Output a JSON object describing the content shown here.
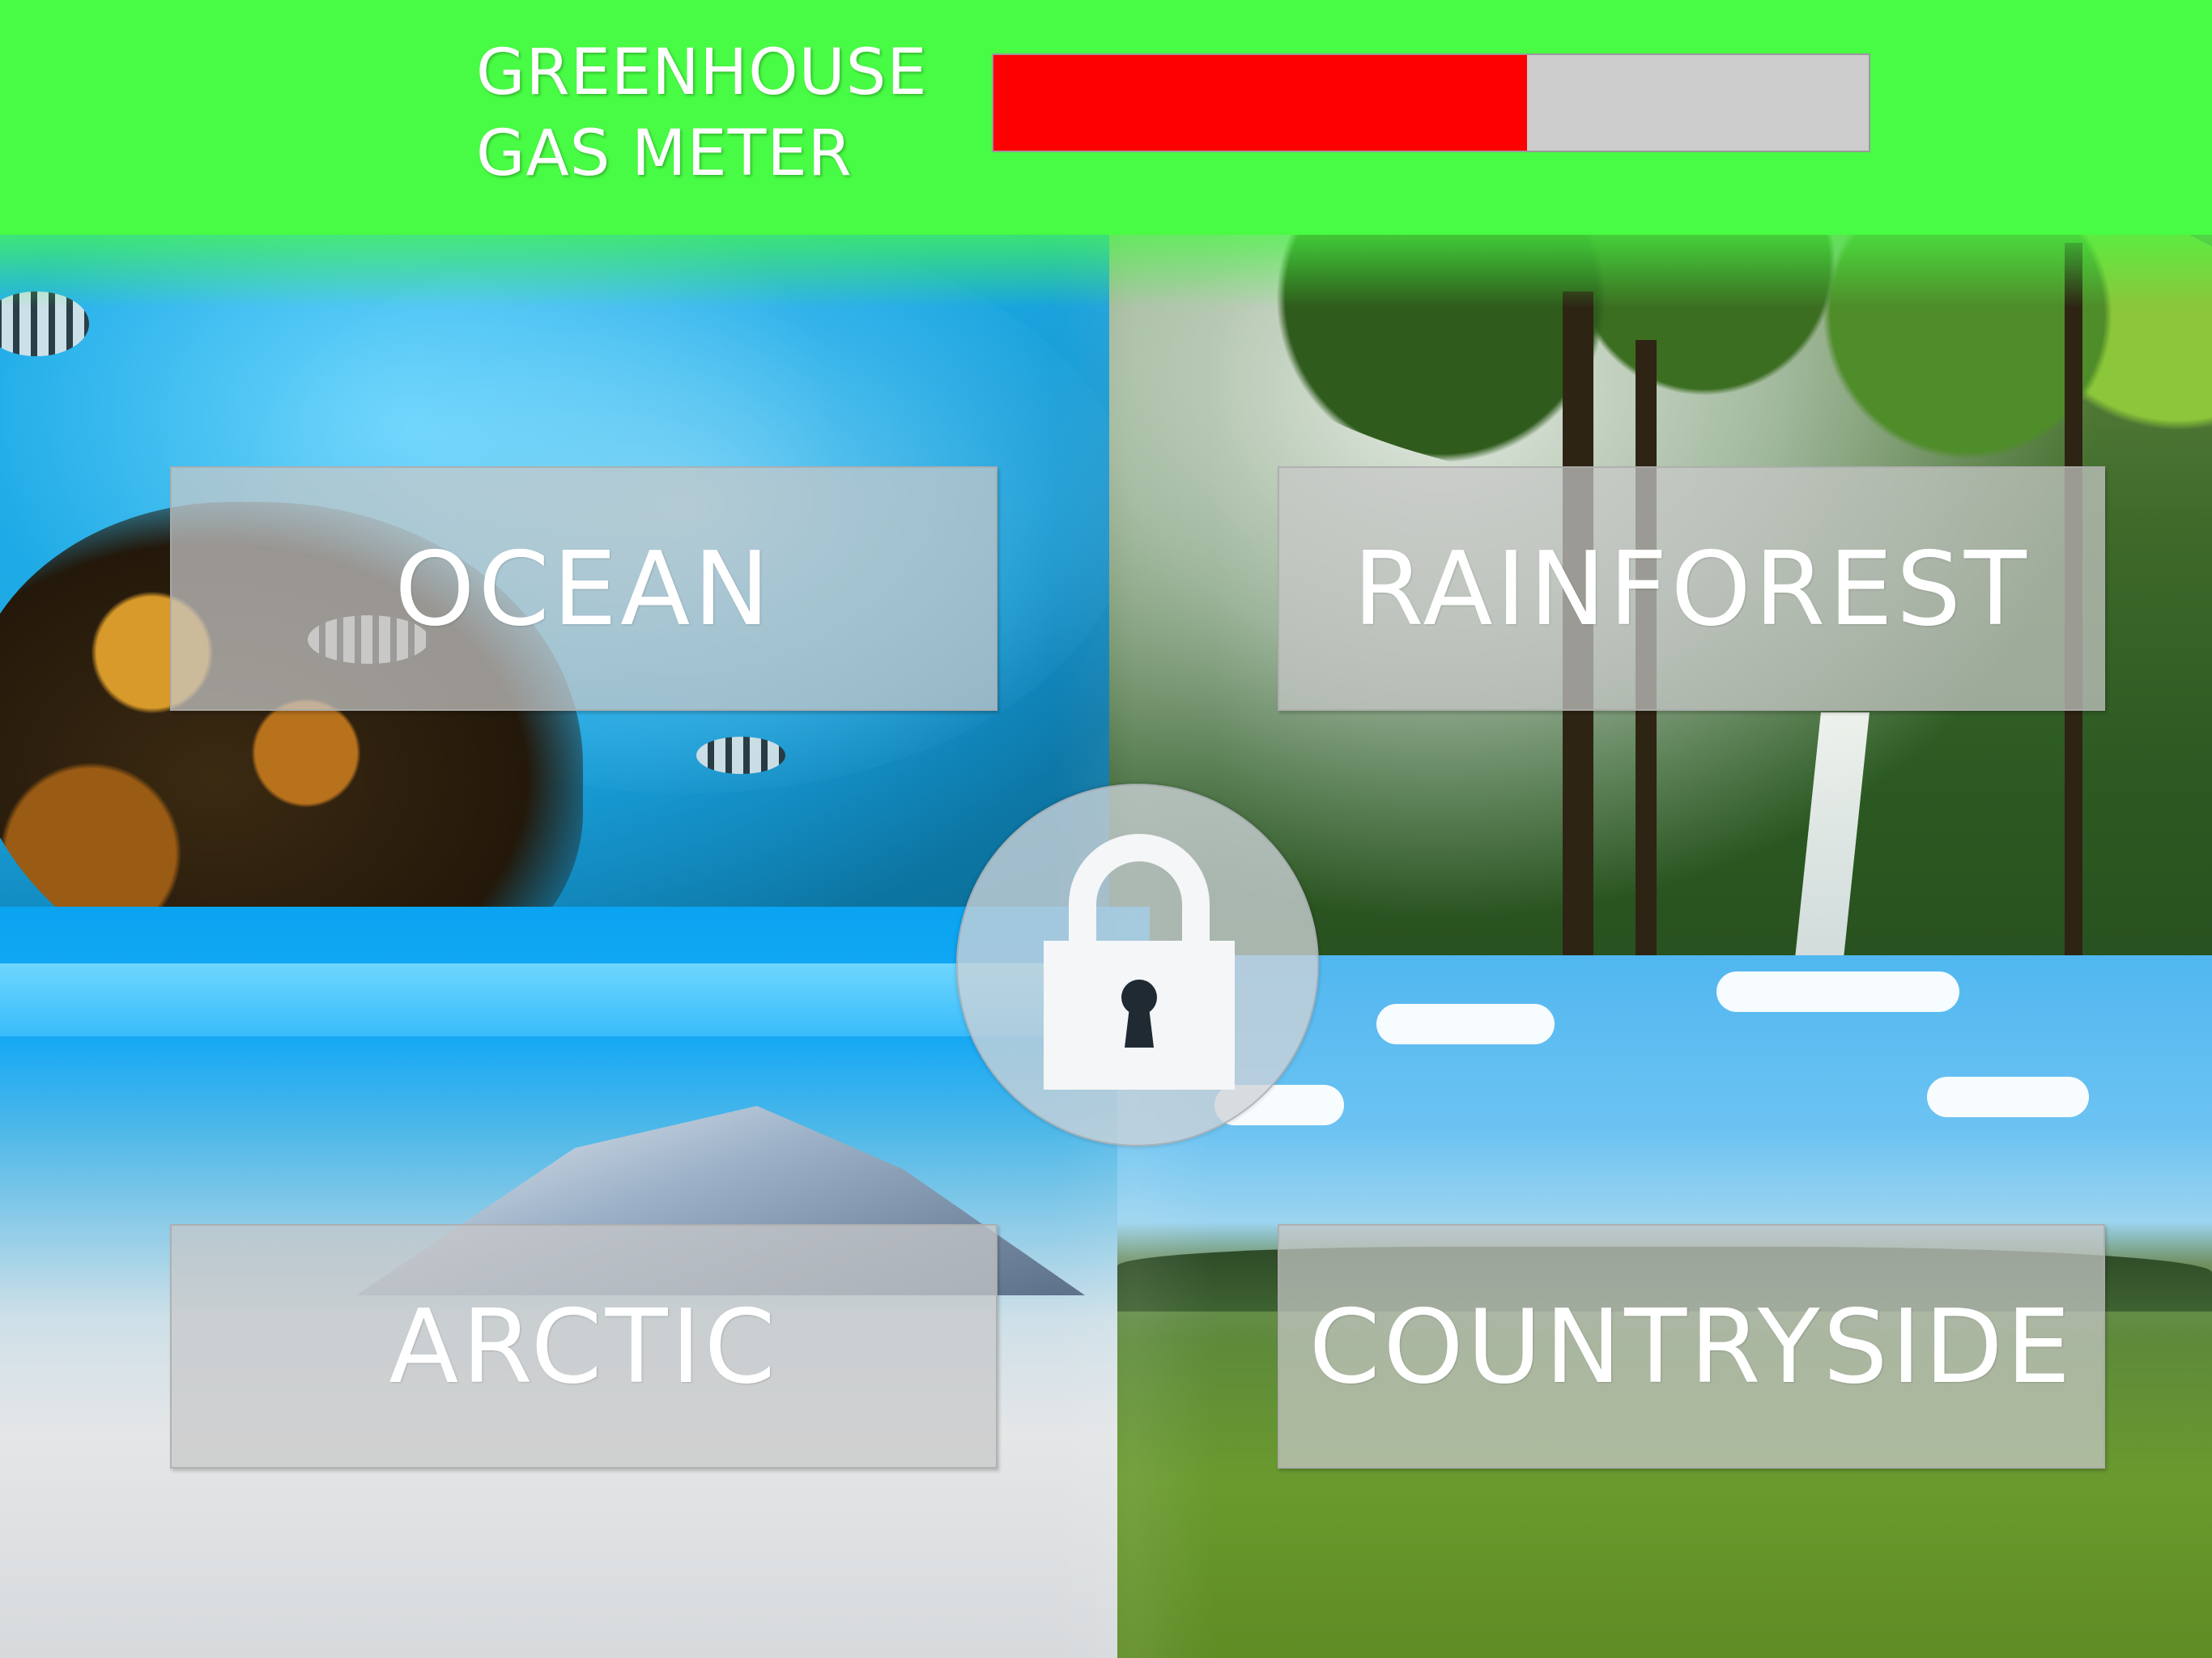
{
  "header": {
    "meter_title_line1": "GREENHOUSE",
    "meter_title_line2": "GAS METER",
    "meter_level_fraction": 0.61,
    "meter_fill_color": "#ff0000",
    "meter_track_color": "#cccccc",
    "background_color": "#48fb44"
  },
  "habitats": {
    "ocean": "OCEAN",
    "rainforest": "RAINFOREST",
    "arctic": "ARCTIC",
    "countryside": "COUNTRYSIDE"
  },
  "lock": {
    "icon": "padlock-icon",
    "state": "locked"
  }
}
